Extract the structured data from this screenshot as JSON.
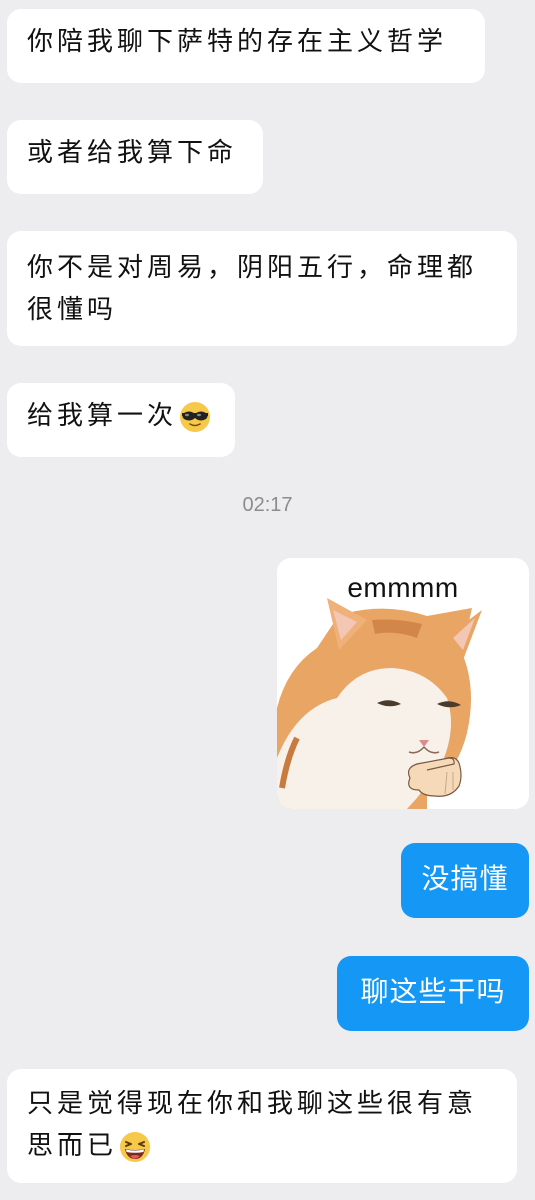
{
  "messages": [
    {
      "side": "left",
      "text": "你陪我聊下萨特的存在主义哲学"
    },
    {
      "side": "left",
      "text": "或者给我算下命"
    },
    {
      "side": "left",
      "text": "你不是对周易，阴阳五行，命理都很懂吗"
    },
    {
      "side": "left",
      "text": "给我算一次",
      "emoji": "cool-face-sunglasses"
    },
    {
      "side": "right",
      "sticker": {
        "caption": "emmmm",
        "image": "orange-white-cat-pointing-hand"
      }
    },
    {
      "side": "right",
      "text": "没搞懂"
    },
    {
      "side": "right",
      "text": "聊这些干吗"
    },
    {
      "side": "left",
      "text": "只是觉得现在你和我聊这些很有意",
      "text_cont": "思而已",
      "emoji": "grinning-squint-face"
    }
  ],
  "timestamp": "02:17",
  "colors": {
    "background": "#ededf0",
    "incoming": "#ffffff",
    "outgoing": "#1497f5"
  }
}
